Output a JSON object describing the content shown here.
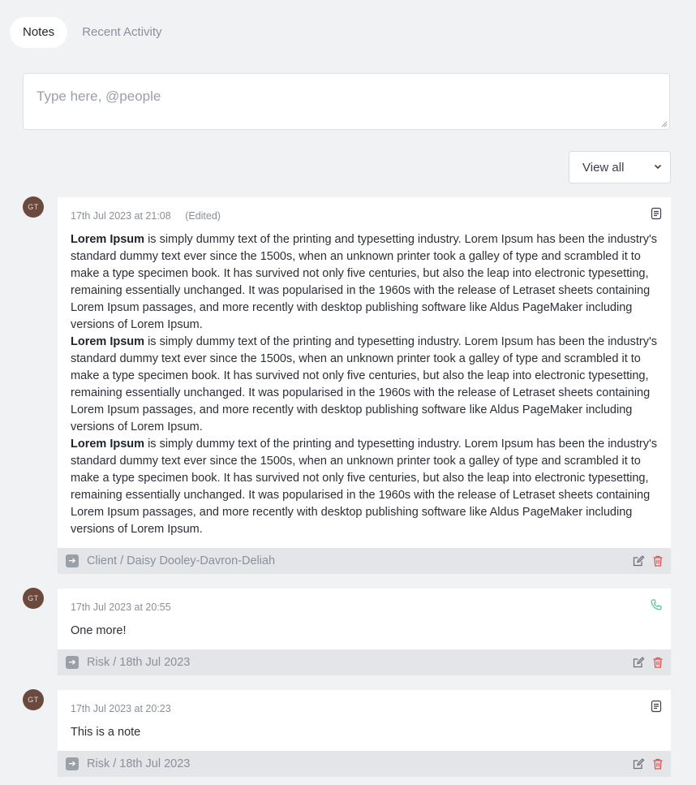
{
  "tabs": [
    {
      "label": "Notes",
      "active": true
    },
    {
      "label": "Recent Activity",
      "active": false
    }
  ],
  "composer": {
    "placeholder": "Type here, @people",
    "value": ""
  },
  "filter": {
    "selected": "View all"
  },
  "notes": [
    {
      "avatar": "GT",
      "timestamp": "17th Jul 2023 at 21:08",
      "edited": "(Edited)",
      "type_icon": "document-icon",
      "paragraphs": [
        {
          "bold": "Lorem Ipsum",
          "text": " is simply dummy text of the printing and typesetting industry. Lorem Ipsum has been the industry's standard dummy text ever since the 1500s, when an unknown printer took a galley of type and scrambled it to make a type specimen book. It has survived not only five centuries, but also the leap into electronic typesetting, remaining essentially unchanged. It was popularised in the 1960s with the release of Letraset sheets containing Lorem Ipsum passages, and more recently with desktop publishing software like Aldus PageMaker including versions of Lorem Ipsum."
        },
        {
          "bold": "Lorem Ipsum",
          "text": " is simply dummy text of the printing and typesetting industry. Lorem Ipsum has been the industry's standard dummy text ever since the 1500s, when an unknown printer took a galley of type and scrambled it to make a type specimen book. It has survived not only five centuries, but also the leap into electronic typesetting, remaining essentially unchanged. It was popularised in the 1960s with the release of Letraset sheets containing Lorem Ipsum passages, and more recently with desktop publishing software like Aldus PageMaker including versions of Lorem Ipsum."
        },
        {
          "bold": "Lorem Ipsum",
          "text": " is simply dummy text of the printing and typesetting industry. Lorem Ipsum has been the industry's standard dummy text ever since the 1500s, when an unknown printer took a galley of type and scrambled it to make a type specimen book. It has survived not only five centuries, but also the leap into electronic typesetting, remaining essentially unchanged. It was popularised in the 1960s with the release of Letraset sheets containing Lorem Ipsum passages, and more recently with desktop publishing software like Aldus PageMaker including versions of Lorem Ipsum."
        }
      ],
      "link": "Client / Daisy Dooley-Davron-Deliah"
    },
    {
      "avatar": "GT",
      "timestamp": "17th Jul 2023 at 20:55",
      "edited": "",
      "type_icon": "phone-icon",
      "paragraphs": [
        {
          "bold": "",
          "text": "One more!"
        }
      ],
      "link": "Risk / 18th Jul 2023"
    },
    {
      "avatar": "GT",
      "timestamp": "17th Jul 2023 at 20:23",
      "edited": "",
      "type_icon": "document-icon",
      "paragraphs": [
        {
          "bold": "",
          "text": "This is a note"
        }
      ],
      "link": "Risk / 18th Jul 2023"
    }
  ],
  "colors": {
    "background": "#f1f2f4",
    "avatar": "#6b4a3e",
    "phone": "#4fc49a",
    "delete": "#d9534f"
  }
}
